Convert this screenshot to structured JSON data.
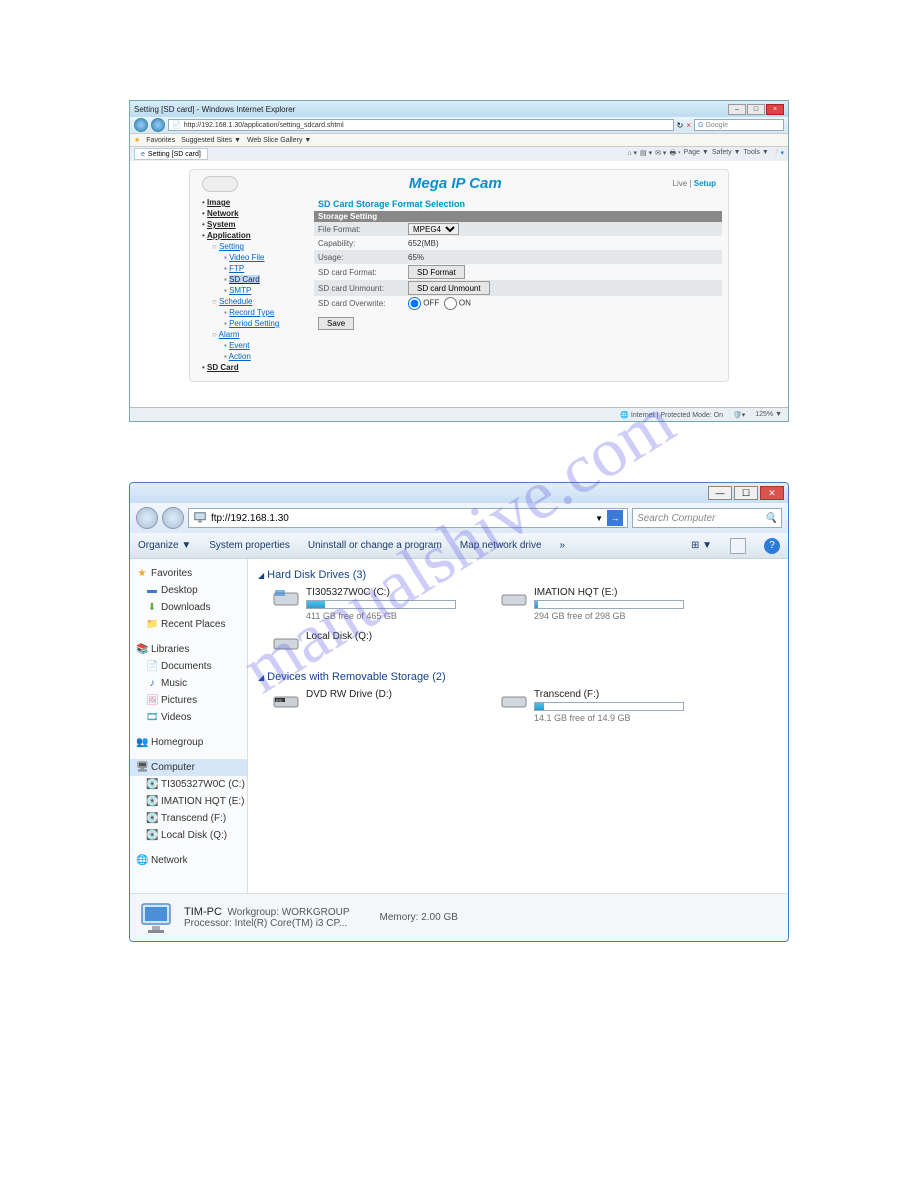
{
  "watermark": "manualshive.com",
  "ie": {
    "title": "Setting [SD card] - Windows Internet Explorer",
    "url": "http://192.168.1.30/application/setting_sdcard.shtml",
    "search_placeholder": "Google",
    "favorites_label": "Favorites",
    "favlinks": [
      "Suggested Sites ▼",
      "Web Slice Gallery ▼"
    ],
    "tab_label": "Setting [SD card]",
    "tools": [
      "Page ▼",
      "Safety ▼",
      "Tools ▼"
    ],
    "status": "Internet | Protected Mode: On",
    "zoom": "125% ▼"
  },
  "cam": {
    "title": "Mega IP Cam",
    "live": "Live",
    "setup": "Setup",
    "nav": {
      "image": "Image",
      "network": "Network",
      "system": "System",
      "application": "Application",
      "setting": "Setting",
      "videofile": "Video File",
      "ftp": "FTP",
      "sdcard": "SD Card",
      "smtp": "SMTP",
      "schedule": "Schedule",
      "recordtype": "Record Type",
      "periodsetting": "Period Setting",
      "alarm": "Alarm",
      "event": "Event",
      "action": "Action",
      "sdcard_main": "SD Card"
    },
    "main": {
      "heading": "SD Card Storage Format Selection",
      "section": "Storage Setting",
      "fileformat_lbl": "File Format:",
      "fileformat_val": "MPEG4",
      "capability_lbl": "Capability:",
      "capability_val": "652(MB)",
      "usage_lbl": "Usage:",
      "usage_val": "65%",
      "sdformat_lbl": "SD card Format:",
      "sdformat_btn": "SD Format",
      "sdunmount_lbl": "SD card Unmount:",
      "sdunmount_btn": "SD card Unmount",
      "overwrite_lbl": "SD card Overwrite:",
      "overwrite_off": "OFF",
      "overwrite_on": "ON",
      "save": "Save"
    }
  },
  "exp": {
    "address": "ftp://192.168.1.30",
    "search_placeholder": "Search Computer",
    "toolbar": {
      "organize": "Organize ▼",
      "sysprop": "System properties",
      "uninstall": "Uninstall or change a program",
      "mapdrive": "Map network drive",
      "more": "»"
    },
    "side": {
      "favorites": "Favorites",
      "desktop": "Desktop",
      "downloads": "Downloads",
      "recent": "Recent Places",
      "libraries": "Libraries",
      "documents": "Documents",
      "music": "Music",
      "pictures": "Pictures",
      "videos": "Videos",
      "homegroup": "Homegroup",
      "computer": "Computer",
      "drive_c": "TI305327W0C (C:)",
      "drive_e": "IMATION HQT (E:)",
      "drive_f": "Transcend (F:)",
      "drive_q": "Local Disk (Q:)",
      "network": "Network"
    },
    "main": {
      "hdd_header": "Hard Disk Drives (3)",
      "hdd": [
        {
          "name": "TI305327W0C (C:)",
          "free": "411 GB free of 465 GB",
          "fill": 12
        },
        {
          "name": "IMATION HQT (E:)",
          "free": "294 GB free of 298 GB",
          "fill": 2
        },
        {
          "name": "Local Disk (Q:)",
          "free": "",
          "fill": null
        }
      ],
      "removable_header": "Devices with Removable Storage (2)",
      "removable": [
        {
          "name": "DVD RW Drive (D:)",
          "free": "",
          "fill": null
        },
        {
          "name": "Transcend (F:)",
          "free": "14.1 GB free of 14.9 GB",
          "fill": 6
        }
      ]
    },
    "details": {
      "name": "TIM-PC",
      "workgroup_lbl": "Workgroup:",
      "workgroup": "WORKGROUP",
      "processor_lbl": "Processor:",
      "processor": "Intel(R) Core(TM) i3 CP...",
      "memory_lbl": "Memory:",
      "memory": "2.00 GB"
    }
  }
}
